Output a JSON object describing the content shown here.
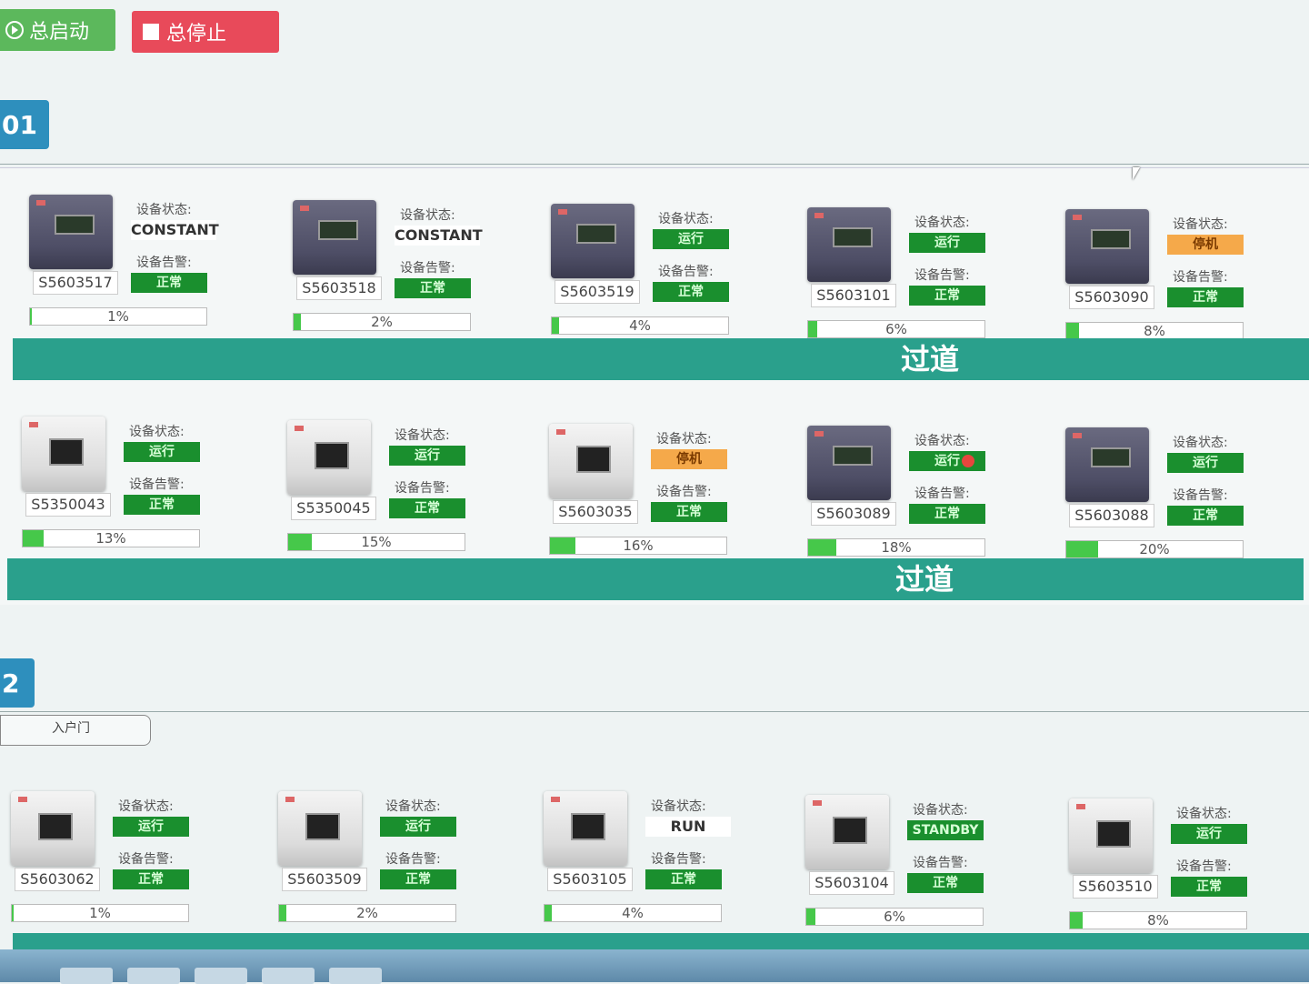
{
  "toolbar": {
    "start_label": "总启动",
    "stop_label": "总停止"
  },
  "groups": [
    {
      "tab": "01"
    },
    {
      "tab": "2"
    }
  ],
  "labels": {
    "status": "设备状态:",
    "alarm": "设备告警:"
  },
  "aisle_label": "过道",
  "entry_door_label": "入户门",
  "rows": [
    {
      "devices": [
        {
          "id": "S5603517",
          "status": "CONSTANT",
          "alarm": "正常",
          "progress": "1%",
          "progress_pct": 1,
          "theme": "dark",
          "status_style": "text"
        },
        {
          "id": "S5603518",
          "status": "CONSTANT",
          "alarm": "正常",
          "progress": "2%",
          "progress_pct": 2,
          "theme": "dark",
          "status_style": "text"
        },
        {
          "id": "S5603519",
          "status": "运行",
          "alarm": "正常",
          "progress": "4%",
          "progress_pct": 4,
          "theme": "dark",
          "status_style": "green"
        },
        {
          "id": "S5603101",
          "status": "运行",
          "alarm": "正常",
          "progress": "6%",
          "progress_pct": 6,
          "theme": "dark",
          "status_style": "green"
        },
        {
          "id": "S5603090",
          "status": "停机",
          "alarm": "正常",
          "progress": "8%",
          "progress_pct": 8,
          "theme": "dark",
          "status_style": "orange"
        }
      ]
    },
    {
      "devices": [
        {
          "id": "S5350043",
          "status": "运行",
          "alarm": "正常",
          "progress": "13%",
          "progress_pct": 13,
          "theme": "light",
          "status_style": "green"
        },
        {
          "id": "S5350045",
          "status": "运行",
          "alarm": "正常",
          "progress": "15%",
          "progress_pct": 15,
          "theme": "light",
          "status_style": "green"
        },
        {
          "id": "S5603035",
          "status": "停机",
          "alarm": "正常",
          "progress": "16%",
          "progress_pct": 16,
          "theme": "light",
          "status_style": "orange"
        },
        {
          "id": "S5603089",
          "status": "运行",
          "alarm": "正常",
          "progress": "18%",
          "progress_pct": 18,
          "theme": "dark",
          "status_style": "green"
        },
        {
          "id": "S5603088",
          "status": "运行",
          "alarm": "正常",
          "progress": "20%",
          "progress_pct": 20,
          "theme": "dark",
          "status_style": "green"
        }
      ]
    },
    {
      "devices": [
        {
          "id": "S5603062",
          "status": "运行",
          "alarm": "正常",
          "progress": "1%",
          "progress_pct": 1,
          "theme": "light",
          "status_style": "green"
        },
        {
          "id": "S5603509",
          "status": "运行",
          "alarm": "正常",
          "progress": "2%",
          "progress_pct": 2,
          "theme": "light",
          "status_style": "green"
        },
        {
          "id": "S5603105",
          "status": "RUN",
          "alarm": "正常",
          "progress": "4%",
          "progress_pct": 4,
          "theme": "light",
          "status_style": "text"
        },
        {
          "id": "S5603104",
          "status": "STANDBY",
          "alarm": "正常",
          "progress": "6%",
          "progress_pct": 6,
          "theme": "light",
          "status_style": "standby"
        },
        {
          "id": "S5603510",
          "status": "运行",
          "alarm": "正常",
          "progress": "8%",
          "progress_pct": 8,
          "theme": "light",
          "status_style": "green"
        }
      ]
    }
  ]
}
